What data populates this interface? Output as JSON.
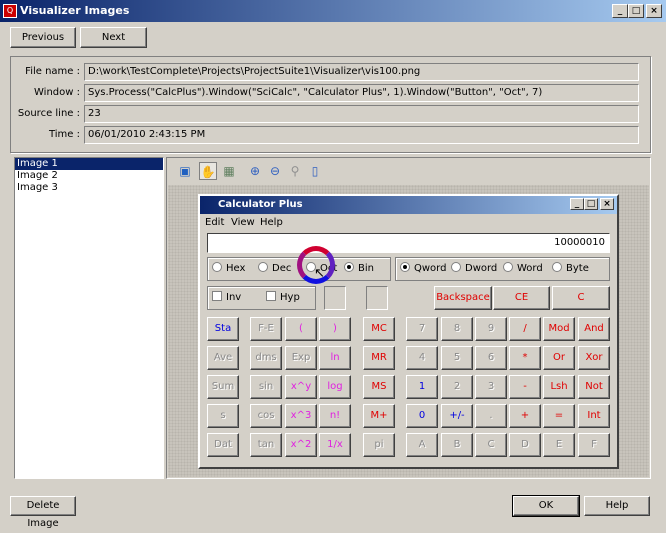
{
  "window": {
    "title": "Visualizer Images",
    "controls": [
      "_",
      "□",
      "×"
    ]
  },
  "nav": {
    "previous": "Previous",
    "next": "Next"
  },
  "details": {
    "file_name_label": "File name :",
    "file_name": "D:\\work\\TestComplete\\Projects\\ProjectSuite1\\Visualizer\\vis100.png",
    "window_label": "Window :",
    "window": "Sys.Process(\"CalcPlus\").Window(\"SciCalc\", \"Calculator Plus\", 1).Window(\"Button\", \"Oct\", 7)",
    "source_line_label": "Source line :",
    "source_line": "23",
    "time_label": "Time :",
    "time": "06/01/2010 2:43:15 PM"
  },
  "images": [
    "Image 1",
    "Image 2",
    "Image 3"
  ],
  "selected_image": "Image 1",
  "toolbar": {
    "icons": [
      "image-icon",
      "hand-icon",
      "select-icon",
      "zoom-in-icon",
      "zoom-out-icon",
      "zoom-reset-icon",
      "page-icon"
    ]
  },
  "calc": {
    "title": "Calculator Plus",
    "menu": [
      "Edit",
      "View",
      "Help"
    ],
    "display": "10000010",
    "radix": [
      {
        "label": "Hex",
        "on": false
      },
      {
        "label": "Dec",
        "on": false
      },
      {
        "label": "Oct",
        "on": false
      },
      {
        "label": "Bin",
        "on": true
      }
    ],
    "size": [
      {
        "label": "Qword",
        "on": true
      },
      {
        "label": "Dword",
        "on": false
      },
      {
        "label": "Word",
        "on": false
      },
      {
        "label": "Byte",
        "on": false
      }
    ],
    "inv": "Inv",
    "hyp": "Hyp",
    "backspace": "Backspace",
    "ce": "CE",
    "c": "C",
    "rows": [
      [
        [
          "Sta",
          "b"
        ],
        [
          "F-E",
          "g"
        ],
        [
          "(",
          "m"
        ],
        [
          ")",
          "m"
        ],
        [
          "MC",
          "r"
        ],
        [
          "7",
          "g"
        ],
        [
          "8",
          "g"
        ],
        [
          "9",
          "g"
        ],
        [
          "/",
          "r"
        ],
        [
          "Mod",
          "r"
        ],
        [
          "And",
          "r"
        ]
      ],
      [
        [
          "Ave",
          "g"
        ],
        [
          "dms",
          "g"
        ],
        [
          "Exp",
          "g"
        ],
        [
          "ln",
          "m"
        ],
        [
          "MR",
          "r"
        ],
        [
          "4",
          "g"
        ],
        [
          "5",
          "g"
        ],
        [
          "6",
          "g"
        ],
        [
          "*",
          "r"
        ],
        [
          "Or",
          "r"
        ],
        [
          "Xor",
          "r"
        ]
      ],
      [
        [
          "Sum",
          "g"
        ],
        [
          "sin",
          "g"
        ],
        [
          "x^y",
          "m"
        ],
        [
          "log",
          "m"
        ],
        [
          "MS",
          "r"
        ],
        [
          "1",
          "b"
        ],
        [
          "2",
          "g"
        ],
        [
          "3",
          "g"
        ],
        [
          "-",
          "r"
        ],
        [
          "Lsh",
          "r"
        ],
        [
          "Not",
          "r"
        ]
      ],
      [
        [
          "s",
          "g"
        ],
        [
          "cos",
          "g"
        ],
        [
          "x^3",
          "m"
        ],
        [
          "n!",
          "m"
        ],
        [
          "M+",
          "r"
        ],
        [
          "0",
          "b"
        ],
        [
          "+/-",
          "b"
        ],
        [
          ".",
          "g"
        ],
        [
          "+",
          "r"
        ],
        [
          "=",
          "r"
        ],
        [
          "Int",
          "r"
        ]
      ],
      [
        [
          "Dat",
          "g"
        ],
        [
          "tan",
          "g"
        ],
        [
          "x^2",
          "m"
        ],
        [
          "1/x",
          "m"
        ],
        [
          "pi",
          "g"
        ],
        [
          "A",
          "g"
        ],
        [
          "B",
          "g"
        ],
        [
          "C",
          "g"
        ],
        [
          "D",
          "g"
        ],
        [
          "E",
          "g"
        ],
        [
          "F",
          "g"
        ]
      ]
    ],
    "colors": {
      "b": "#0000e0",
      "g": "#8a8a8a",
      "m": "#e020e0",
      "r": "#e00000"
    }
  },
  "footer": {
    "delete": "Delete Image",
    "ok": "OK",
    "help": "Help"
  }
}
